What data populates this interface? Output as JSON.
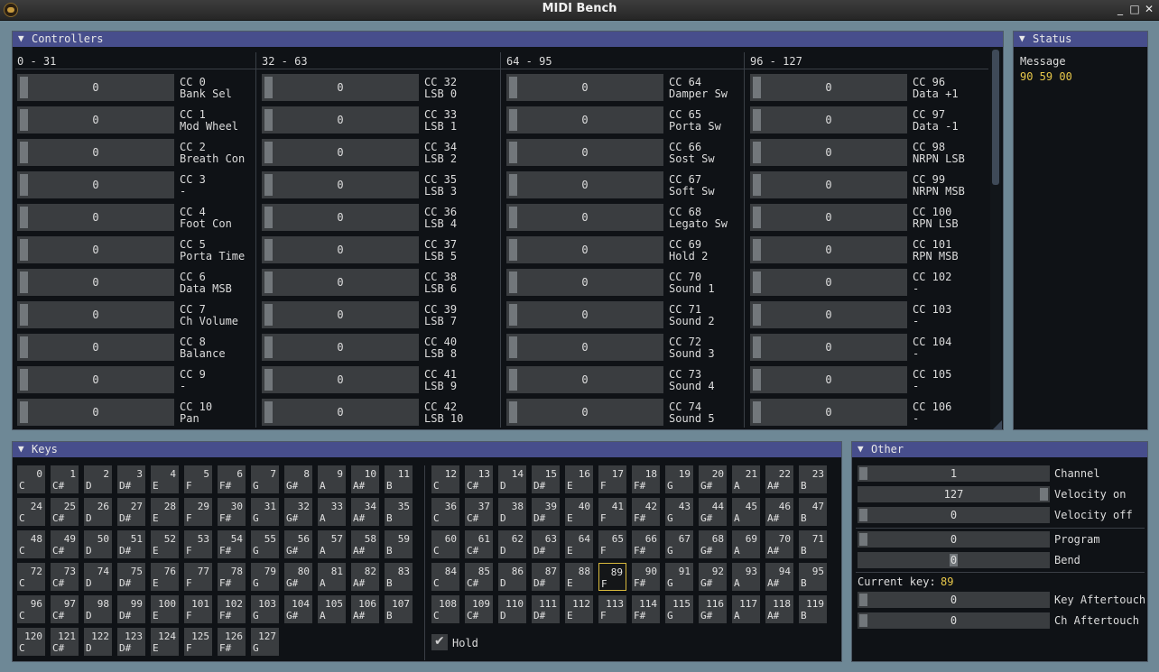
{
  "window": {
    "title": "MIDI Bench",
    "minimize": "_",
    "maximize": "□",
    "close": "✕"
  },
  "panel_arrow": "▼",
  "controllers": {
    "title": "Controllers",
    "columns": [
      {
        "header": "0 - 31",
        "items": [
          {
            "cc": "CC 0",
            "name": "Bank Sel",
            "value": 0
          },
          {
            "cc": "CC 1",
            "name": "Mod Wheel",
            "value": 0
          },
          {
            "cc": "CC 2",
            "name": "Breath Con",
            "value": 0
          },
          {
            "cc": "CC 3",
            "name": "-",
            "value": 0
          },
          {
            "cc": "CC 4",
            "name": "Foot Con",
            "value": 0
          },
          {
            "cc": "CC 5",
            "name": "Porta Time",
            "value": 0
          },
          {
            "cc": "CC 6",
            "name": "Data MSB",
            "value": 0
          },
          {
            "cc": "CC 7",
            "name": "Ch Volume",
            "value": 0
          },
          {
            "cc": "CC 8",
            "name": "Balance",
            "value": 0
          },
          {
            "cc": "CC 9",
            "name": "-",
            "value": 0
          },
          {
            "cc": "CC 10",
            "name": "Pan",
            "value": 0
          }
        ]
      },
      {
        "header": "32 - 63",
        "items": [
          {
            "cc": "CC 32",
            "name": "LSB 0",
            "value": 0
          },
          {
            "cc": "CC 33",
            "name": "LSB 1",
            "value": 0
          },
          {
            "cc": "CC 34",
            "name": "LSB 2",
            "value": 0
          },
          {
            "cc": "CC 35",
            "name": "LSB 3",
            "value": 0
          },
          {
            "cc": "CC 36",
            "name": "LSB 4",
            "value": 0
          },
          {
            "cc": "CC 37",
            "name": "LSB 5",
            "value": 0
          },
          {
            "cc": "CC 38",
            "name": "LSB 6",
            "value": 0
          },
          {
            "cc": "CC 39",
            "name": "LSB 7",
            "value": 0
          },
          {
            "cc": "CC 40",
            "name": "LSB 8",
            "value": 0
          },
          {
            "cc": "CC 41",
            "name": "LSB 9",
            "value": 0
          },
          {
            "cc": "CC 42",
            "name": "LSB 10",
            "value": 0
          }
        ]
      },
      {
        "header": "64 - 95",
        "items": [
          {
            "cc": "CC 64",
            "name": "Damper Sw",
            "value": 0
          },
          {
            "cc": "CC 65",
            "name": "Porta Sw",
            "value": 0
          },
          {
            "cc": "CC 66",
            "name": "Sost Sw",
            "value": 0
          },
          {
            "cc": "CC 67",
            "name": "Soft Sw",
            "value": 0
          },
          {
            "cc": "CC 68",
            "name": "Legato Sw",
            "value": 0
          },
          {
            "cc": "CC 69",
            "name": "Hold 2",
            "value": 0
          },
          {
            "cc": "CC 70",
            "name": "Sound 1",
            "value": 0
          },
          {
            "cc": "CC 71",
            "name": "Sound 2",
            "value": 0
          },
          {
            "cc": "CC 72",
            "name": "Sound 3",
            "value": 0
          },
          {
            "cc": "CC 73",
            "name": "Sound 4",
            "value": 0
          },
          {
            "cc": "CC 74",
            "name": "Sound 5",
            "value": 0
          }
        ]
      },
      {
        "header": "96 - 127",
        "items": [
          {
            "cc": "CC 96",
            "name": "Data +1",
            "value": 0
          },
          {
            "cc": "CC 97",
            "name": "Data -1",
            "value": 0
          },
          {
            "cc": "CC 98",
            "name": "NRPN LSB",
            "value": 0
          },
          {
            "cc": "CC 99",
            "name": "NRPN MSB",
            "value": 0
          },
          {
            "cc": "CC 100",
            "name": "RPN LSB",
            "value": 0
          },
          {
            "cc": "CC 101",
            "name": "RPN MSB",
            "value": 0
          },
          {
            "cc": "CC 102",
            "name": "-",
            "value": 0
          },
          {
            "cc": "CC 103",
            "name": "-",
            "value": 0
          },
          {
            "cc": "CC 104",
            "name": "-",
            "value": 0
          },
          {
            "cc": "CC 105",
            "name": "-",
            "value": 0
          },
          {
            "cc": "CC 106",
            "name": "-",
            "value": 0
          }
        ]
      }
    ]
  },
  "status": {
    "title": "Status",
    "message_label": "Message",
    "message_value": "90 59 00"
  },
  "keys": {
    "title": "Keys",
    "note_names": [
      "C",
      "C#",
      "D",
      "D#",
      "E",
      "F",
      "F#",
      "G",
      "G#",
      "A",
      "A#",
      "B"
    ],
    "selected": 89,
    "hold_label": "Hold",
    "hold_checked": true
  },
  "other": {
    "title": "Other",
    "channel": {
      "label": "Channel",
      "value": 1,
      "min": 1,
      "max": 16
    },
    "velocity_on": {
      "label": "Velocity on",
      "value": 127,
      "min": 0,
      "max": 127
    },
    "velocity_off": {
      "label": "Velocity off",
      "value": 0,
      "min": 0,
      "max": 127
    },
    "program": {
      "label": "Program",
      "value": 0,
      "min": 0,
      "max": 127
    },
    "bend": {
      "label": "Bend",
      "value": 0,
      "min": -8192,
      "max": 8191
    },
    "current_key_label": "Current key:",
    "current_key_value": "89",
    "key_aftertouch": {
      "label": "Key Aftertouch",
      "value": 0,
      "min": 0,
      "max": 127
    },
    "ch_aftertouch": {
      "label": "Ch Aftertouch",
      "value": 0,
      "min": 0,
      "max": 127
    }
  },
  "colors": {
    "accent": "#474e8c",
    "highlight": "#e8c84a",
    "frame": "#6e8896"
  }
}
